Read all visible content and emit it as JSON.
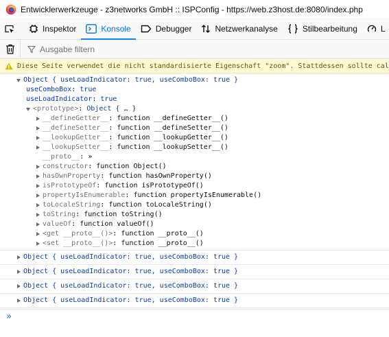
{
  "window": {
    "title": "Entwicklerwerkzeuge - z3networks GmbH :: ISPConfig - https://web.z3host.de:8080/index.php"
  },
  "toolbar": {
    "tabs": [
      {
        "label": "Inspektor",
        "icon": "inspector-icon",
        "selected": false
      },
      {
        "label": "Konsole",
        "icon": "console-icon",
        "selected": true
      },
      {
        "label": "Debugger",
        "icon": "debugger-icon",
        "selected": false
      },
      {
        "label": "Netzwerkanalyse",
        "icon": "network-icon",
        "selected": false
      },
      {
        "label": "Stilbearbeitung",
        "icon": "style-editor-icon",
        "selected": false
      },
      {
        "label": "L",
        "icon": "performance-icon",
        "selected": false
      }
    ]
  },
  "filterbar": {
    "placeholder": "Ausgabe filtern"
  },
  "console": {
    "warning": "Diese Seite verwendet die nicht standardisierte Eigenschaft \"zoom\". Stattdessen sollte calc",
    "expanded": {
      "header": "Object { useLoadIndicator: true, useComboBox: true }",
      "props": [
        {
          "key": "useComboBox",
          "value": "true"
        },
        {
          "key": "useLoadIndicator",
          "value": "true"
        }
      ],
      "prototype": {
        "header_key": "<prototype>",
        "header_value": "Object { … }",
        "entries": [
          {
            "key": "__defineGetter__",
            "value": "function __defineGetter__()",
            "expandable": true
          },
          {
            "key": "__defineSetter__",
            "value": "function __defineSetter__()",
            "expandable": true
          },
          {
            "key": "__lookupGetter__",
            "value": "function __lookupGetter__()",
            "expandable": true
          },
          {
            "key": "__lookupSetter__",
            "value": "function __lookupSetter__()",
            "expandable": true
          },
          {
            "key": "__proto__",
            "value": "»",
            "expandable": false
          },
          {
            "key": "constructor",
            "value": "function Object()",
            "expandable": true
          },
          {
            "key": "hasOwnProperty",
            "value": "function hasOwnProperty()",
            "expandable": true
          },
          {
            "key": "isPrototypeOf",
            "value": "function isPrototypeOf()",
            "expandable": true
          },
          {
            "key": "propertyIsEnumerable",
            "value": "function propertyIsEnumerable()",
            "expandable": true
          },
          {
            "key": "toLocaleString",
            "value": "function toLocaleString()",
            "expandable": true
          },
          {
            "key": "toString",
            "value": "function toString()",
            "expandable": true
          },
          {
            "key": "valueOf",
            "value": "function valueOf()",
            "expandable": true
          },
          {
            "key": "<get __proto__()>",
            "value": "function __proto__()",
            "expandable": true
          },
          {
            "key": "<set __proto__()>",
            "value": "function __proto__()",
            "expandable": true
          }
        ]
      }
    },
    "collapsed": [
      "Object { useLoadIndicator: true, useComboBox: true }",
      "Object { useLoadIndicator: true, useComboBox: true }",
      "Object { useLoadIndicator: true, useComboBox: true }",
      "Object { useLoadIndicator: true, useComboBox: true }"
    ],
    "prompt": "»"
  },
  "colors": {
    "accent": "#0a84ff",
    "warning_bg": "#fffbd6",
    "object_blue": "#003eaa"
  }
}
